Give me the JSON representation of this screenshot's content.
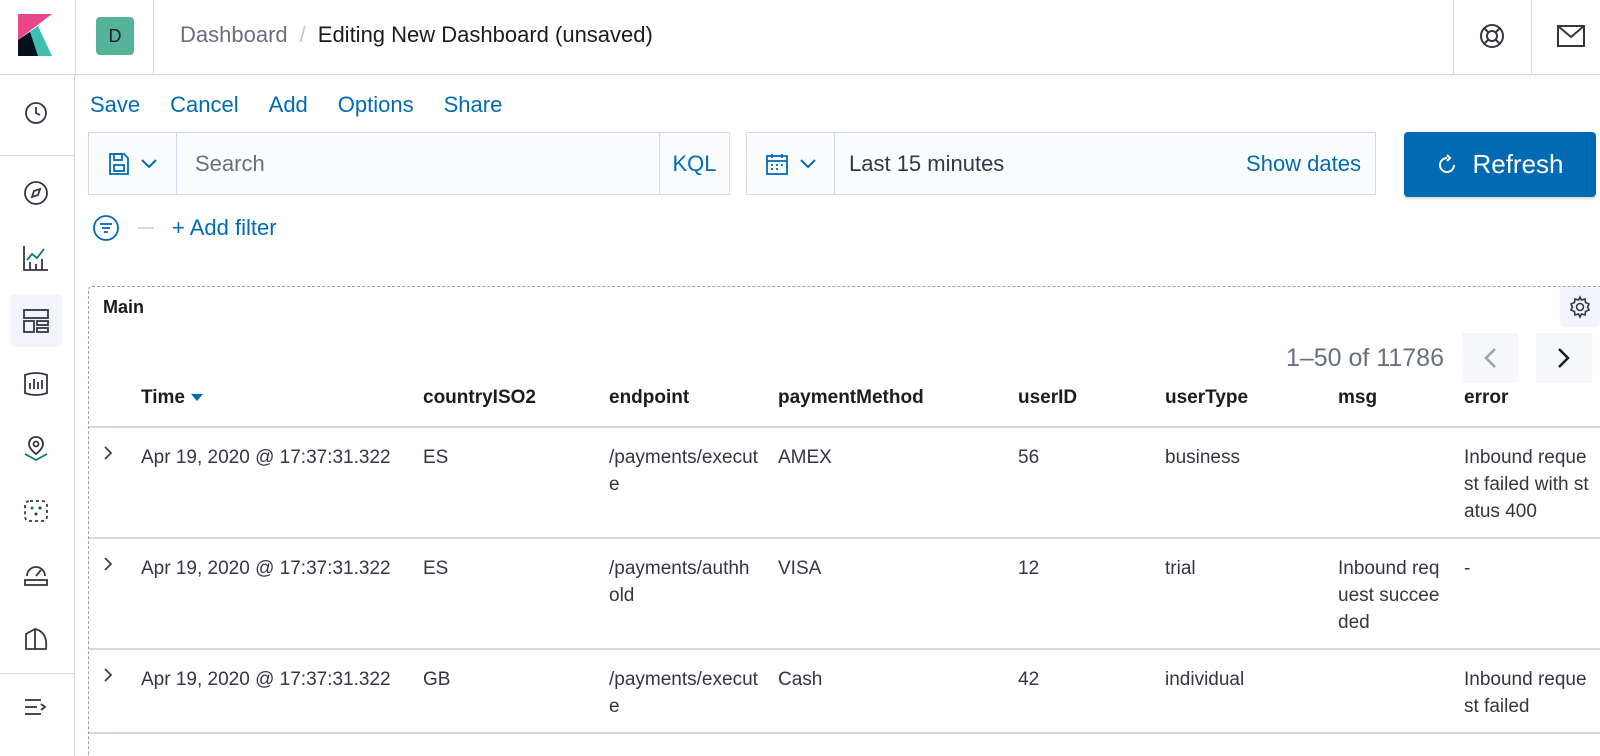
{
  "header": {
    "space_initial": "D",
    "breadcrumbs": [
      "Dashboard",
      "Editing New Dashboard (unsaved)"
    ],
    "breadcrumb_separator": "/"
  },
  "topmenu": [
    "Save",
    "Cancel",
    "Add",
    "Options",
    "Share"
  ],
  "query": {
    "placeholder": "Search",
    "language": "KQL"
  },
  "time": {
    "range": "Last 15 minutes",
    "show_dates": "Show dates",
    "refresh": "Refresh"
  },
  "filters": {
    "add_filter": "+ Add filter"
  },
  "panel": {
    "title": "Main",
    "pagination": "1–50 of 11786",
    "columns": [
      "Time",
      "countryISO2",
      "endpoint",
      "paymentMethod",
      "userID",
      "userType",
      "msg",
      "error"
    ],
    "rows": [
      [
        "Apr 19, 2020 @ 17:37:31.322",
        "ES",
        "/payments/execute",
        "AMEX",
        "56",
        "business",
        "",
        "Inbound request failed with status 400"
      ],
      [
        "Apr 19, 2020 @ 17:37:31.322",
        "ES",
        "/payments/authhold",
        "VISA",
        "12",
        "trial",
        "Inbound request succeeded",
        "-"
      ],
      [
        "Apr 19, 2020 @ 17:37:31.322",
        "GB",
        "/payments/execute",
        "Cash",
        "42",
        "individual",
        "",
        "Inbound request failed"
      ]
    ]
  },
  "nav_icons": [
    "clock-icon",
    "compass-icon",
    "visualize-icon",
    "dashboard-icon",
    "canvas-icon",
    "maps-icon",
    "ml-icon",
    "metrics-icon",
    "logs-icon",
    "dock-icon"
  ],
  "colors": {
    "accent": "#006bb4",
    "space_avatar": "#54b399",
    "border": "#d3dae6"
  }
}
